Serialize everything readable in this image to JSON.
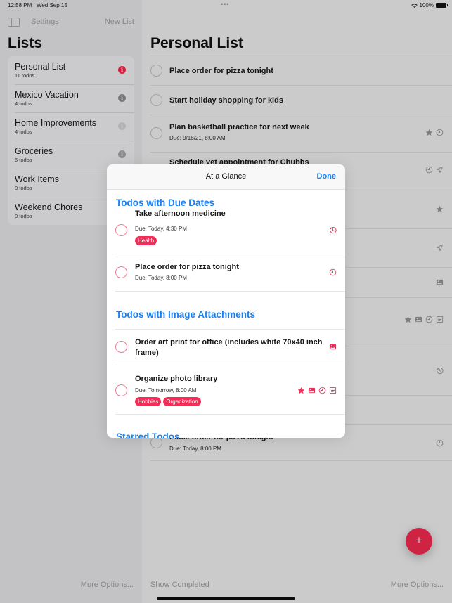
{
  "status_bar": {
    "time": "12:58 PM",
    "date": "Wed Sep 15",
    "battery": "100%"
  },
  "sidebar": {
    "settings_label": "Settings",
    "new_list_label": "New List",
    "title": "Lists",
    "lists": [
      {
        "name": "Personal List",
        "count": "11 todos",
        "info_color": "#d81f42"
      },
      {
        "name": "Mexico Vacation",
        "count": "4 todos",
        "info_color": "#79797d"
      },
      {
        "name": "Home Improvements",
        "count": "4 todos",
        "info_color": "#b3b3b6"
      },
      {
        "name": "Groceries",
        "count": "6 todos",
        "info_color": "#8c8c90"
      },
      {
        "name": "Work Items",
        "count": "0 todos",
        "info_color": "#8c8c90"
      },
      {
        "name": "Weekend Chores",
        "count": "0 todos",
        "info_color": "#8c8c90"
      }
    ],
    "more_options_label": "More Options..."
  },
  "main": {
    "title": "Personal List",
    "todos": [
      {
        "title": "Place order for pizza tonight",
        "due": ""
      },
      {
        "title": "Start holiday shopping for kids",
        "due": ""
      },
      {
        "title": "Plan basketball practice for next week",
        "due": "Due: 9/18/21, 8:00 AM",
        "icons": [
          "star-icon",
          "clock-icon"
        ]
      },
      {
        "title": "Schedule vet appointment for Chubbs",
        "due": "",
        "icons": [
          "clock-icon",
          "location-icon"
        ]
      },
      {
        "title": "",
        "icons": [
          "star-icon"
        ]
      },
      {
        "title": "",
        "icons": [
          "location-icon"
        ]
      },
      {
        "title": "Order art print for office (includes white 70x40 inch frame)",
        "icons": [
          "image-icon"
        ]
      },
      {
        "title": "",
        "icons": [
          "star-icon",
          "image-icon",
          "clock-icon",
          "note-icon"
        ]
      },
      {
        "title": "",
        "icons": [
          "recurring-clock-icon"
        ]
      },
      {
        "title": ""
      },
      {
        "title": "Place order for pizza tonight",
        "due": "Due: Today, 8:00 PM",
        "icons": [
          "clock-icon"
        ]
      }
    ],
    "show_completed_label": "Show Completed",
    "more_options_label": "More Options...",
    "add_button_label": "+"
  },
  "modal": {
    "title": "At a Glance",
    "done_label": "Done",
    "sections": [
      {
        "title": "Todos with Due Dates",
        "todos": [
          {
            "title": "Take afternoon medicine",
            "due": "Due: Today, 4:30 PM",
            "tags": [
              "Health"
            ],
            "icons": [
              "recurring-clock-icon"
            ]
          },
          {
            "title": "Place order for pizza tonight",
            "due": "Due: Today, 8:00 PM",
            "tags": [],
            "icons": [
              "clock-icon"
            ]
          }
        ]
      },
      {
        "title": "Todos with Image Attachments",
        "todos": [
          {
            "title": "Order art print for office (includes white 70x40 inch frame)",
            "due": "",
            "tags": [],
            "icons": [
              "image-icon"
            ]
          },
          {
            "title": "Organize photo library",
            "due": "Due: Tomorrow, 8:00 AM",
            "tags": [
              "Hobbies",
              "Organization"
            ],
            "icons": [
              "star-icon",
              "image-icon",
              "clock-icon",
              "note-icon"
            ]
          }
        ]
      },
      {
        "title": "Starred Todos",
        "todos": []
      }
    ]
  },
  "colors": {
    "accent_red": "#f02e58",
    "link_blue": "#1a80f0",
    "fab_red": "#cf2343"
  }
}
